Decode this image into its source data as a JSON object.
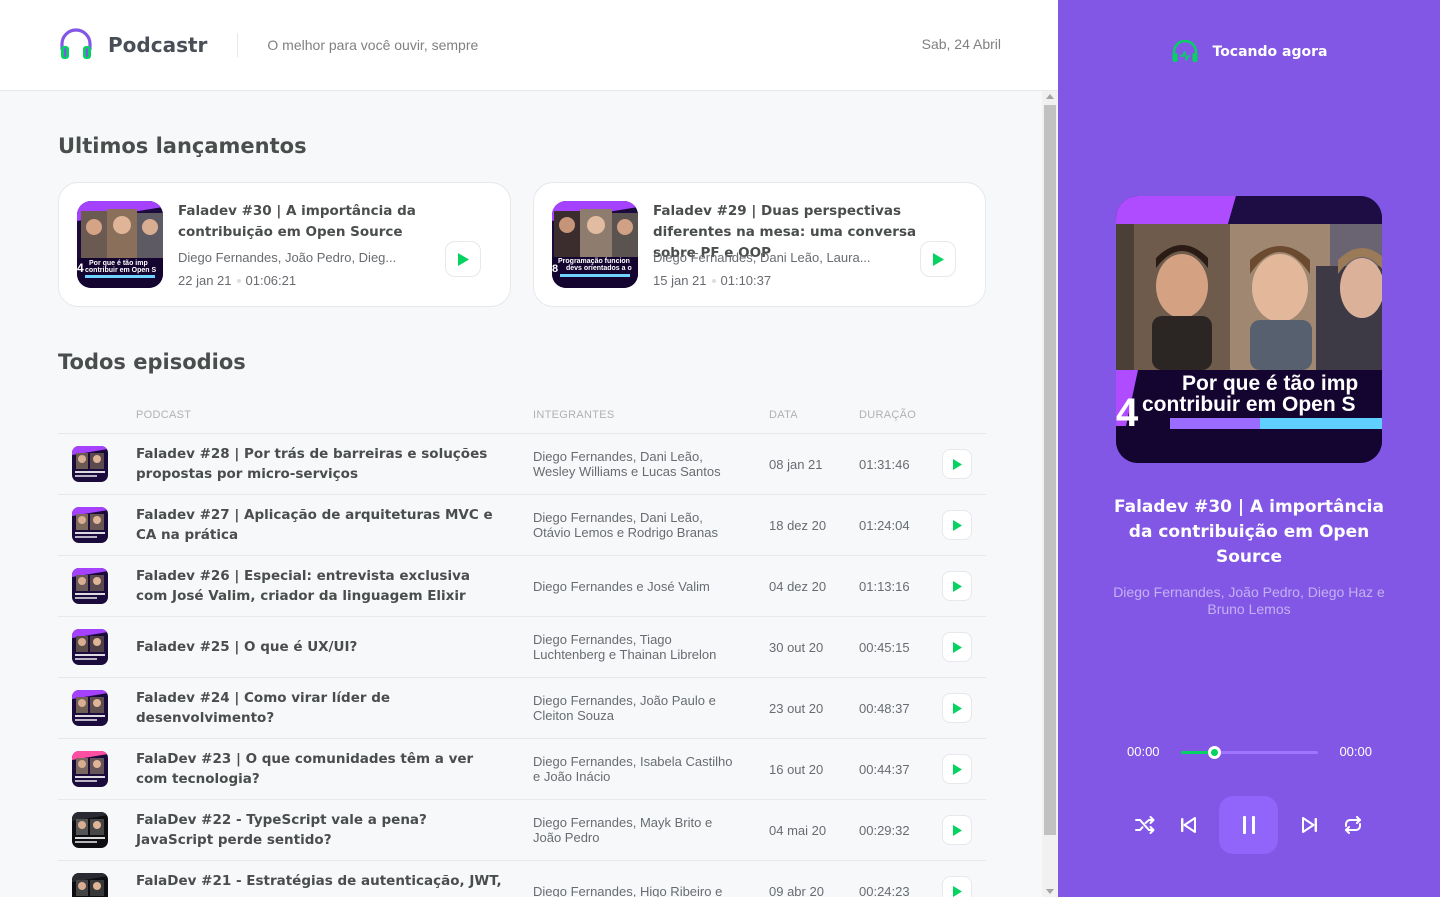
{
  "header": {
    "brand": "Podcastr",
    "tagline": "O melhor para você ouvir, sempre",
    "date": "Sab, 24 Abril"
  },
  "latest": {
    "title": "Ultimos lançamentos",
    "episodes": [
      {
        "title": "Faladev #30 | A importância da contribuição em Open Source",
        "members": "Diego Fernandes, João Pedro, Dieg...",
        "date": "22 jan 21",
        "duration": "01:06:21"
      },
      {
        "title": "Faladev #29 | Duas perspectivas diferentes na mesa: uma conversa sobre PF e OOP",
        "members": "Diego Fernandes, Dani Leão, Laura...",
        "date": "15 jan 21",
        "duration": "01:10:37"
      }
    ]
  },
  "all": {
    "title": "Todos episodios",
    "columns": [
      "Podcast",
      "Integrantes",
      "Data",
      "Duração"
    ],
    "episodes": [
      {
        "title": "Faladev #28 | Por trás de barreiras e soluções propostas por micro-serviços",
        "members": "Diego Fernandes, Dani Leão, Wesley Williams e Lucas Santos",
        "date": "08 jan 21",
        "duration": "01:31:46"
      },
      {
        "title": "Faladev #27 | Aplicação de arquiteturas MVC e CA na prática",
        "members": "Diego Fernandes, Dani Leão, Otávio Lemos e Rodrigo Branas",
        "date": "18 dez 20",
        "duration": "01:24:04"
      },
      {
        "title": "Faladev #26 | Especial: entrevista exclusiva com José Valim, criador da linguagem Elixir",
        "members": "Diego Fernandes e José Valim",
        "date": "04 dez 20",
        "duration": "01:13:16"
      },
      {
        "title": "Faladev #25 | O que é UX/UI?",
        "members": "Diego Fernandes, Tiago Luchtenberg e Thainan Librelon",
        "date": "30 out 20",
        "duration": "00:45:15"
      },
      {
        "title": "Faladev #24 | Como virar líder de desenvolvimento?",
        "members": "Diego Fernandes, João Paulo e Cleiton Souza",
        "date": "23 out 20",
        "duration": "00:48:37"
      },
      {
        "title": "FalaDev #23 | O que comunidades têm a ver com tecnologia?",
        "members": "Diego Fernandes, Isabela Castilho e João Inácio",
        "date": "16 out 20",
        "duration": "00:44:37"
      },
      {
        "title": "FalaDev #22 - TypeScript vale a pena? JavaScript perde sentido?",
        "members": "Diego Fernandes, Mayk Brito e João Pedro",
        "date": "04 mai 20",
        "duration": "00:29:32"
      },
      {
        "title": "FalaDev #21 - Estratégias de autenticação, JWT,",
        "members": "Diego Fernandes, Higo Ribeiro e",
        "date": "09 abr 20",
        "duration": "00:24:23"
      }
    ]
  },
  "player": {
    "heading": "Tocando agora",
    "cover_caption_line1": "Por que é tão imp",
    "cover_caption_line2": "contribuir em Open S",
    "cover_number": "4",
    "title": "Faladev #30 | A importância da contribuição em Open Source",
    "members": "Diego Fernandes, João Pedro, Diego Haz e Bruno Lemos",
    "current_time": "00:00",
    "total_time": "00:00",
    "progress_fraction": 0.24,
    "icons": [
      "shuffle-icon",
      "previous-icon",
      "pause-icon",
      "next-icon",
      "repeat-icon"
    ]
  },
  "colors": {
    "purple": "#8257e5",
    "green": "#04d361",
    "pause_button": "#9164fa"
  }
}
